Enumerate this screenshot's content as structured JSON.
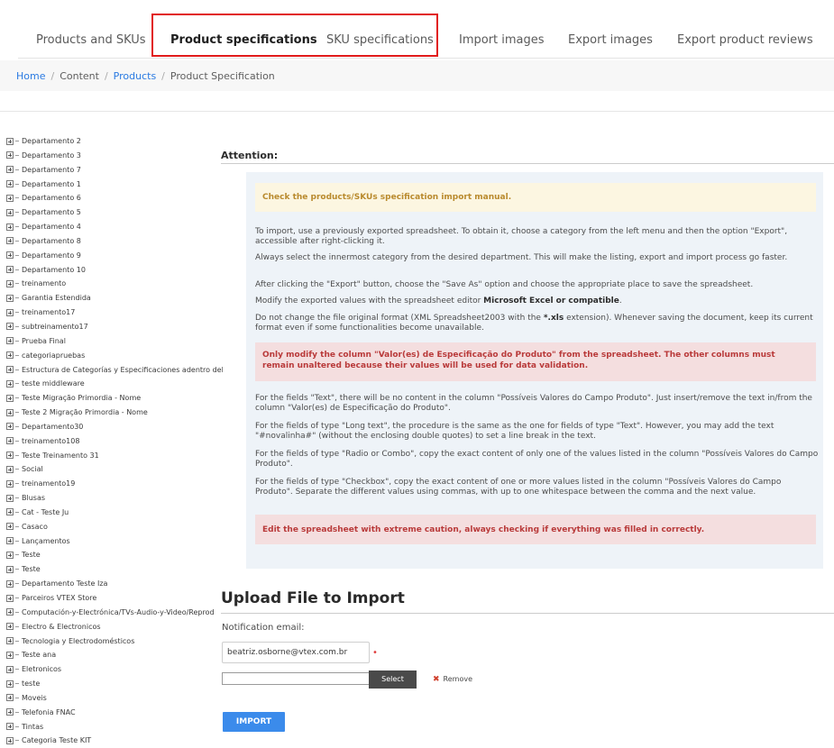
{
  "tabs": [
    {
      "label": "Products and SKUs",
      "active": false
    },
    {
      "label": "Product specifications",
      "active": true
    },
    {
      "label": "SKU specifications",
      "active": false
    },
    {
      "label": "Import images",
      "active": false
    },
    {
      "label": "Export images",
      "active": false
    },
    {
      "label": "Export product reviews",
      "active": false
    }
  ],
  "breadcrumb": {
    "home": "Home",
    "content": "Content",
    "products": "Products",
    "current": "Product Specification",
    "separator": "/"
  },
  "tree": {
    "items": [
      "Departamento 2",
      "Departamento 3",
      "Departamento 7",
      "Departamento 1",
      "Departamento 6",
      "Departamento 5",
      "Departamento 4",
      "Departamento 8",
      "Departamento 9",
      "Departamento 10",
      "treinamento",
      "Garantia Estendida",
      "treinamento17",
      "subtreinamento17",
      "Prueba Final",
      "categoriapruebas",
      "Estructura de Categorías y Especificaciones adentro del Ambie",
      "teste middleware",
      "Teste Migração Primordia - Nome",
      "Teste 2 Migração Primordia - Nome",
      "Departamento30",
      "treinamento108",
      "Teste Treinamento 31",
      "Social",
      "treinamento19",
      "Blusas",
      "Cat - Teste Ju",
      "Casaco",
      "Lançamentos",
      "Teste",
      "Teste",
      "Departamento Teste Iza",
      "Parceiros VTEX Store",
      "Computación-y-Electrónica/TVs-Audio-y-Video/Reprod",
      "Electro & Electronicos",
      "Tecnologia y Electrodomésticos",
      "Teste ana",
      "Eletronicos",
      "teste",
      "Moveis",
      "Telefonia FNAC",
      "Tintas",
      "Categoria Teste KIT"
    ]
  },
  "attention": {
    "title": "Attention:",
    "manual": "Check the products/SKUs specification import manual.",
    "p1": "To import, use a previously exported spreadsheet. To obtain it, choose a category from the left menu and then the option \"Export\", accessible after right-clicking it.",
    "p2": "Always select the innermost category from the desired department. This will make the listing, export and import process go faster.",
    "p3": "After clicking the \"Export\" button, choose the \"Save As\" option and choose the appropriate place to save the spreadsheet.",
    "p4_prefix": "Modify the exported values with the spreadsheet editor ",
    "p4_bold": "Microsoft Excel or compatible",
    "p4_suffix": ".",
    "p5_prefix": "Do not change the file original format (XML Spreadsheet2003 with the ",
    "p5_bold": "*.xls",
    "p5_suffix": " extension). Whenever saving the document, keep its current format even if some functionalities become unavailable.",
    "warning1": "Only modify the column \"Valor(es) de Especificação do Produto\" from the spreadsheet. The other columns must remain unaltered because their values will be used for data validation.",
    "p6": "For the fields \"Text\", there will be no content in the column \"Possíveis Valores do Campo Produto\". Just insert/remove the text in/from the column \"Valor(es) de Especificação do Produto\".",
    "p7": "For the fields of type \"Long text\", the procedure is the same as the one for fields of type \"Text\". However, you may add the text \"#novalinha#\" (without the enclosing double quotes) to set a line break in the text.",
    "p8": "For the fields of type \"Radio or Combo\", copy the exact content of only one of the values listed in the column \"Possíveis Valores do Campo Produto\".",
    "p9": "For the fields of type \"Checkbox\", copy the exact content of one or more values listed in the column \"Possíveis Valores do Campo Produto\". Separate the different values using commas, with up to one whitespace between the comma and the next value.",
    "warning2": "Edit the spreadsheet with extreme caution, always checking if everything was filled in correctly."
  },
  "upload": {
    "title": "Upload File to Import",
    "email_label": "Notification email:",
    "email_value": "beatriz.osborne@vtex.com.br",
    "required_mark": "•",
    "select_label": "Select",
    "remove_label": "Remove",
    "remove_icon_glyph": "✖",
    "import_label": "IMPORT"
  },
  "colors": {
    "accent_blue": "#3b8beb",
    "link_blue": "#2a7ae2",
    "highlight_red": "#e11b1b",
    "panel_bg": "#eef3f8",
    "warning_text": "#b93a3a",
    "notice_text": "#b98a2d"
  }
}
